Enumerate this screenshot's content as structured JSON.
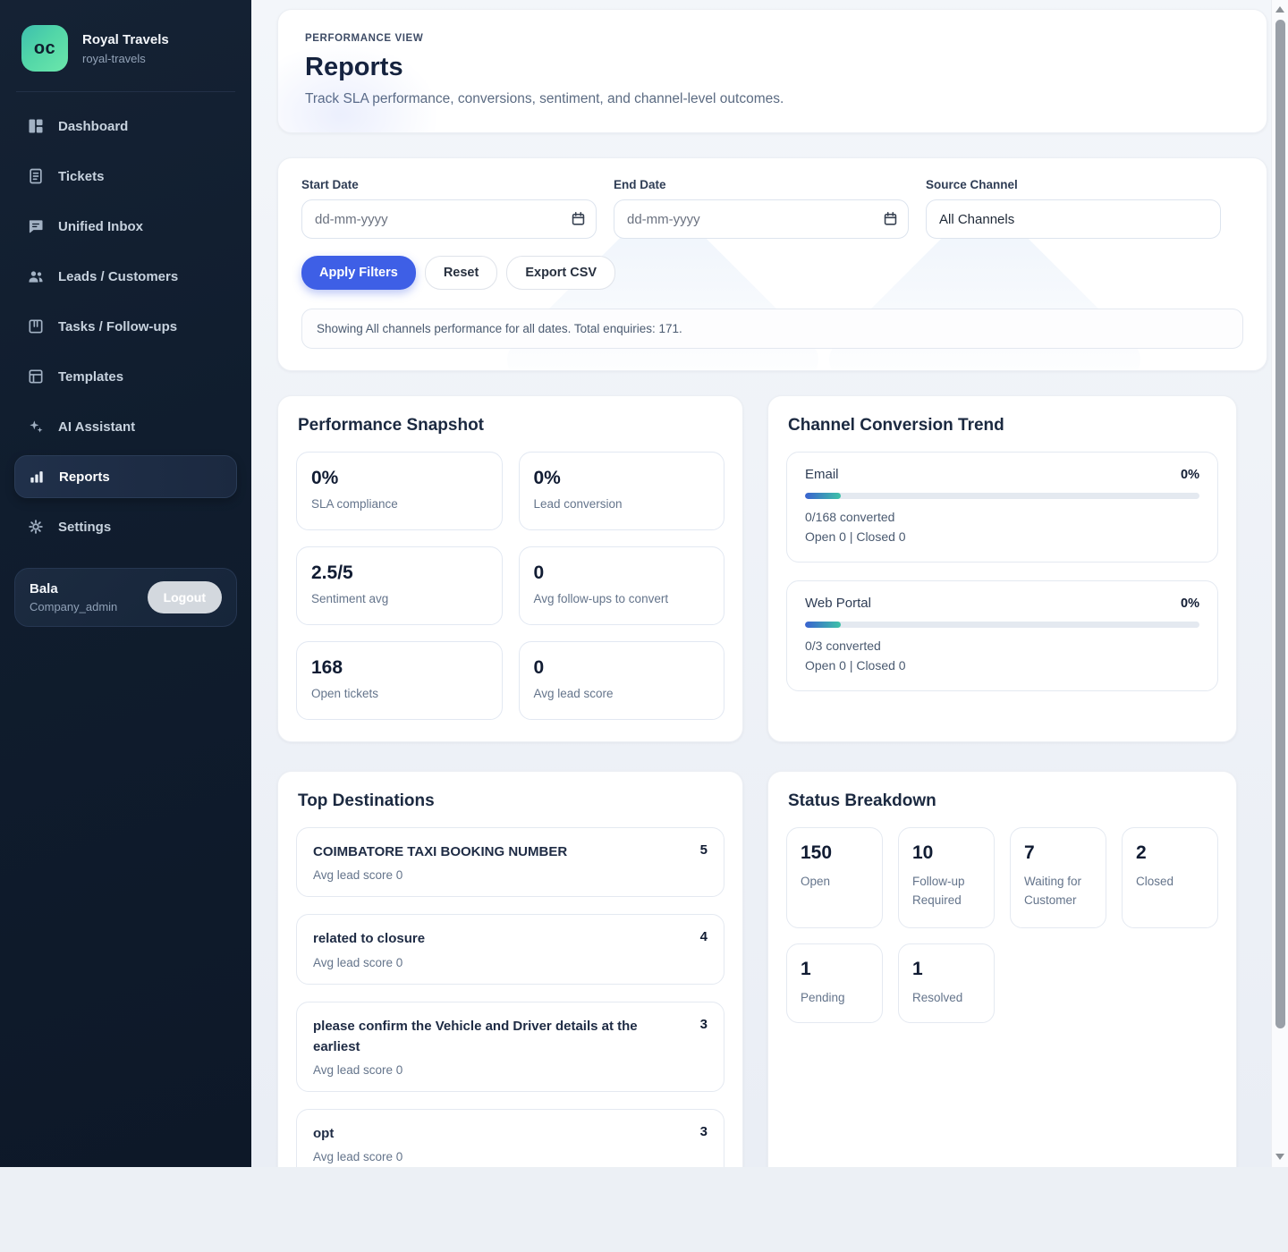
{
  "brand": {
    "initials": "oc",
    "name": "Royal Travels",
    "slug": "royal-travels"
  },
  "sidebar": {
    "items": [
      {
        "label": "Dashboard",
        "icon": "dashboard-icon"
      },
      {
        "label": "Tickets",
        "icon": "tickets-icon"
      },
      {
        "label": "Unified Inbox",
        "icon": "inbox-icon"
      },
      {
        "label": "Leads / Customers",
        "icon": "users-icon"
      },
      {
        "label": "Tasks / Follow-ups",
        "icon": "tasks-icon"
      },
      {
        "label": "Templates",
        "icon": "templates-icon"
      },
      {
        "label": "AI Assistant",
        "icon": "sparkles-icon"
      },
      {
        "label": "Reports",
        "icon": "bar-chart-icon",
        "active": true
      },
      {
        "label": "Settings",
        "icon": "gear-icon"
      }
    ]
  },
  "user": {
    "name": "Bala",
    "role": "Company_admin",
    "logout_label": "Logout"
  },
  "header": {
    "eyebrow": "PERFORMANCE VIEW",
    "title": "Reports",
    "subtitle": "Track SLA performance, conversions, sentiment, and channel-level outcomes."
  },
  "filters": {
    "start_date": {
      "label": "Start Date",
      "placeholder": "dd-mm-yyyy"
    },
    "end_date": {
      "label": "End Date",
      "placeholder": "dd-mm-yyyy"
    },
    "source_channel": {
      "label": "Source Channel",
      "value": "All Channels"
    },
    "apply_label": "Apply Filters",
    "reset_label": "Reset",
    "export_label": "Export CSV",
    "status_text": "Showing All channels performance for all dates. Total enquiries: 171."
  },
  "snapshot": {
    "title": "Performance Snapshot",
    "stats": [
      {
        "value": "0%",
        "label": "SLA compliance"
      },
      {
        "value": "0%",
        "label": "Lead conversion"
      },
      {
        "value": "2.5/5",
        "label": "Sentiment avg"
      },
      {
        "value": "0",
        "label": "Avg follow-ups to convert"
      },
      {
        "value": "168",
        "label": "Open tickets"
      },
      {
        "value": "0",
        "label": "Avg lead score"
      }
    ]
  },
  "channels": {
    "title": "Channel Conversion Trend",
    "items": [
      {
        "name": "Email",
        "pct": "0%",
        "converted": "0/168 converted",
        "open_closed": "Open 0 | Closed 0"
      },
      {
        "name": "Web Portal",
        "pct": "0%",
        "converted": "0/3 converted",
        "open_closed": "Open 0 | Closed 0"
      }
    ]
  },
  "destinations": {
    "title": "Top Destinations",
    "items": [
      {
        "name": "COIMBATORE TAXI BOOKING NUMBER",
        "count": "5",
        "score": "Avg lead score 0"
      },
      {
        "name": "related to closure",
        "count": "4",
        "score": "Avg lead score 0"
      },
      {
        "name": "please confirm the Vehicle and Driver details at the earliest",
        "count": "3",
        "score": "Avg lead score 0"
      },
      {
        "name": "opt",
        "count": "3",
        "score": "Avg lead score 0"
      }
    ]
  },
  "status_breakdown": {
    "title": "Status Breakdown",
    "items": [
      {
        "value": "150",
        "label": "Open"
      },
      {
        "value": "10",
        "label": "Follow-up Required"
      },
      {
        "value": "7",
        "label": "Waiting for Customer"
      },
      {
        "value": "2",
        "label": "Closed"
      },
      {
        "value": "1",
        "label": "Pending"
      },
      {
        "value": "1",
        "label": "Resolved"
      }
    ]
  },
  "colors": {
    "accent_blue": "#3e5fe6",
    "logo_gradient_start": "#3dbfae",
    "logo_gradient_end": "#6ce7ab",
    "progress_gradient_start": "#3a62d0",
    "progress_gradient_end": "#3ec2a7",
    "sidebar_bg": "#101d2e"
  }
}
